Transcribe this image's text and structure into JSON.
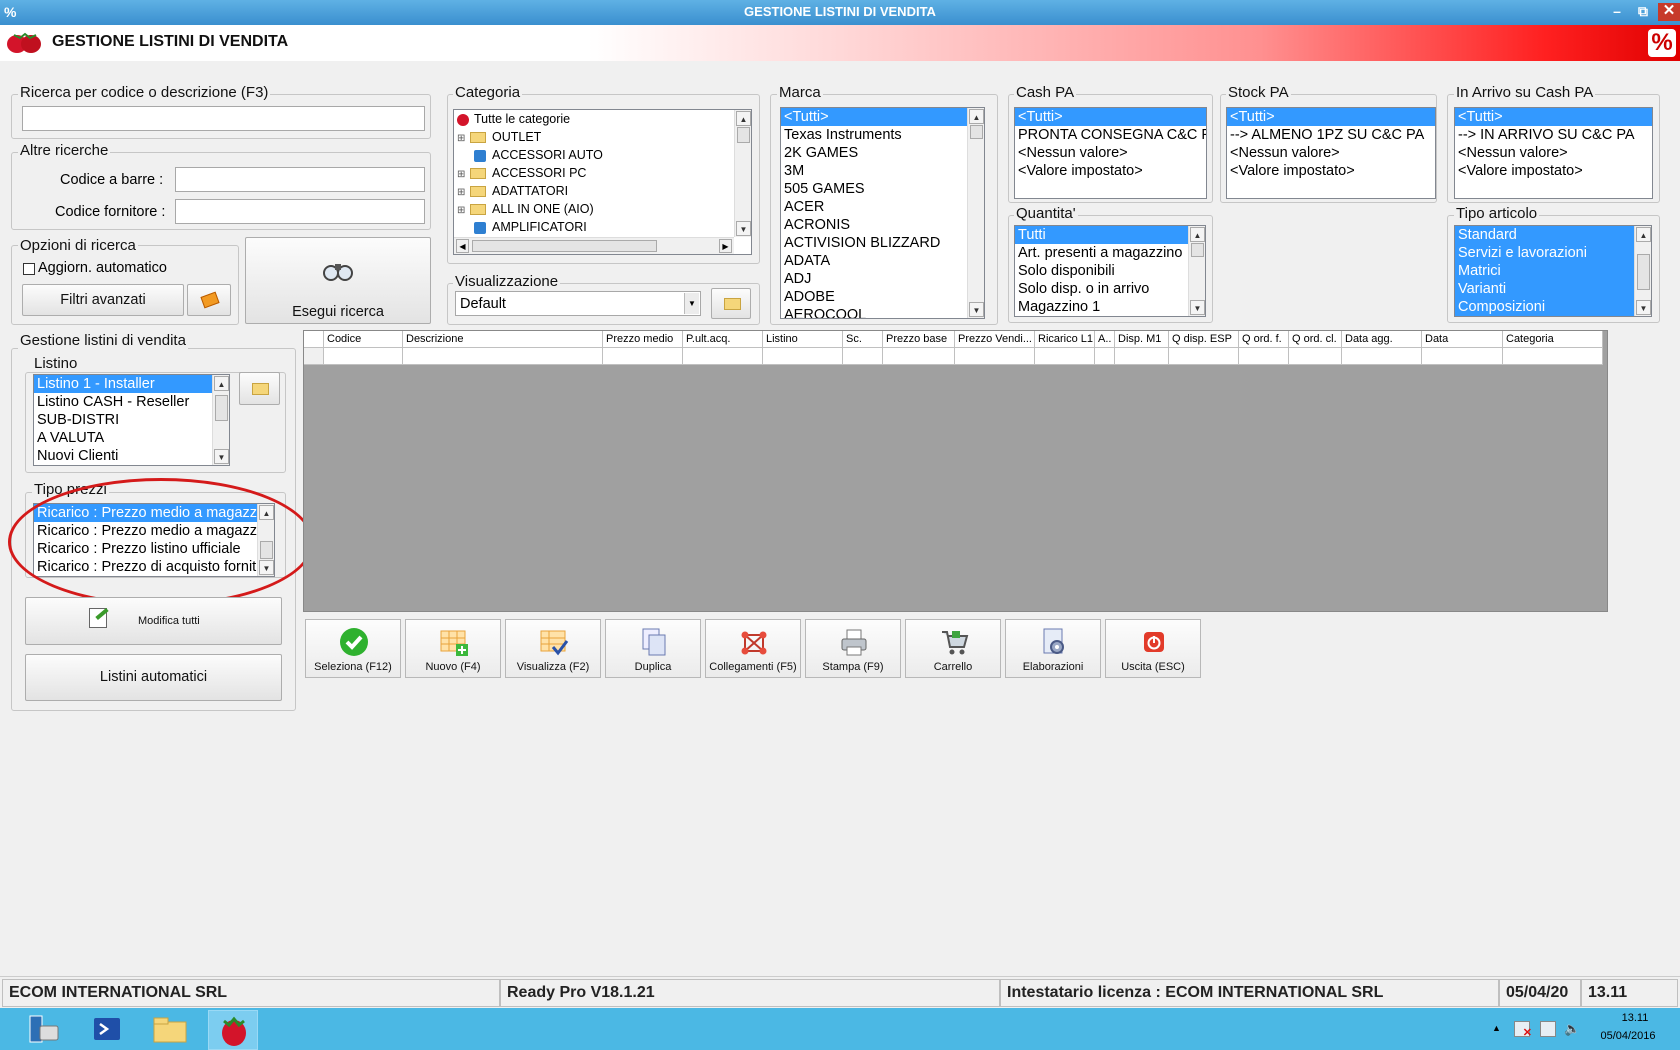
{
  "window": {
    "title": "GESTIONE LISTINI DI VENDITA"
  },
  "header": {
    "title": "GESTIONE LISTINI DI VENDITA"
  },
  "search": {
    "label": "Ricerca per codice o descrizione (F3)",
    "value": ""
  },
  "altre": {
    "label": "Altre ricerche",
    "barcode_label": "Codice a barre :",
    "supplier_label": "Codice fornitore :"
  },
  "opzioni": {
    "label": "Opzioni di ricerca",
    "auto_label": "Aggiorn. automatico",
    "filtri_label": "Filtri avanzati",
    "esegui_label": "Esegui ricerca"
  },
  "gestione": {
    "label": "Gestione listini di vendita",
    "listino_label": "Listino",
    "listino_items": [
      "Listino 1 - Installer",
      "Listino CASH - Reseller",
      "SUB-DISTRI",
      "A VALUTA",
      "Nuovi Clienti"
    ],
    "tipo_label": "Tipo prezzi",
    "tipo_items": [
      "Ricarico : Prezzo medio a magazz",
      "Ricarico : Prezzo medio a magazz",
      "Ricarico : Prezzo listino ufficiale",
      "Ricarico : Prezzo di acquisto fornit"
    ],
    "modifica_label": "Modifica tutti",
    "automatici_label": "Listini automatici"
  },
  "categoria": {
    "label": "Categoria",
    "items": [
      "Tutte le categorie",
      "OUTLET",
      "ACCESSORI AUTO",
      "ACCESSORI PC",
      "ADATTATORI",
      "ALL IN ONE (AIO)",
      "AMPLIFICATORI"
    ]
  },
  "visualizzazione": {
    "label": "Visualizzazione",
    "value": "Default"
  },
  "marca": {
    "label": "Marca",
    "items": [
      "<Tutti>",
      "Texas Instruments",
      "2K GAMES",
      "3M",
      "505 GAMES",
      "ACER",
      "ACRONIS",
      "ACTIVISION BLIZZARD",
      "ADATA",
      "ADJ",
      "ADOBE",
      "AEROCOOL"
    ]
  },
  "cash_pa": {
    "label": "Cash PA",
    "items": [
      "<Tutti>",
      "PRONTA CONSEGNA C&C PA",
      "<Nessun valore>",
      "<Valore impostato>"
    ]
  },
  "stock_pa": {
    "label": "Stock PA",
    "items": [
      "<Tutti>",
      "--> ALMENO 1PZ SU C&C PA",
      "<Nessun valore>",
      "<Valore impostato>"
    ]
  },
  "arrivo_pa": {
    "label": "In Arrivo su Cash PA",
    "items": [
      "<Tutti>",
      "--> IN ARRIVO SU C&C PA",
      "<Nessun valore>",
      "<Valore impostato>"
    ]
  },
  "quantita": {
    "label": "Quantita'",
    "items": [
      "Tutti",
      "Art. presenti a magazzino",
      "Solo disponibili",
      "Solo disp. o in arrivo",
      "Magazzino 1"
    ]
  },
  "tipo_articolo": {
    "label": "Tipo articolo",
    "items": [
      "Standard",
      "Servizi e lavorazioni",
      "Matrici",
      "Varianti",
      "Composizioni"
    ]
  },
  "grid": {
    "columns": [
      "Codice",
      "Descrizione",
      "Prezzo medio",
      "P.ult.acq.",
      "Listino",
      "Sc.",
      "Prezzo base",
      "Prezzo Vendi...",
      "Ricarico L1",
      "A..",
      "Disp. M1",
      "Q disp. ESP",
      "Q ord. f.",
      "Q ord. cl.",
      "Data agg.",
      "Data",
      "Categoria"
    ]
  },
  "toolbar": {
    "buttons": [
      "Seleziona (F12)",
      "Nuovo (F4)",
      "Visualizza (F2)",
      "Duplica",
      "Collegamenti (F5)",
      "Stampa (F9)",
      "Carrello",
      "Elaborazioni",
      "Uscita (ESC)"
    ]
  },
  "status": {
    "company": "ECOM INTERNATIONAL SRL",
    "version": "Ready Pro V18.1.21",
    "license": "Intestatario licenza : ECOM INTERNATIONAL SRL",
    "date": "05/04/20",
    "time": "13.11"
  },
  "taskbar": {
    "time": "13.11",
    "date": "05/04/2016"
  }
}
